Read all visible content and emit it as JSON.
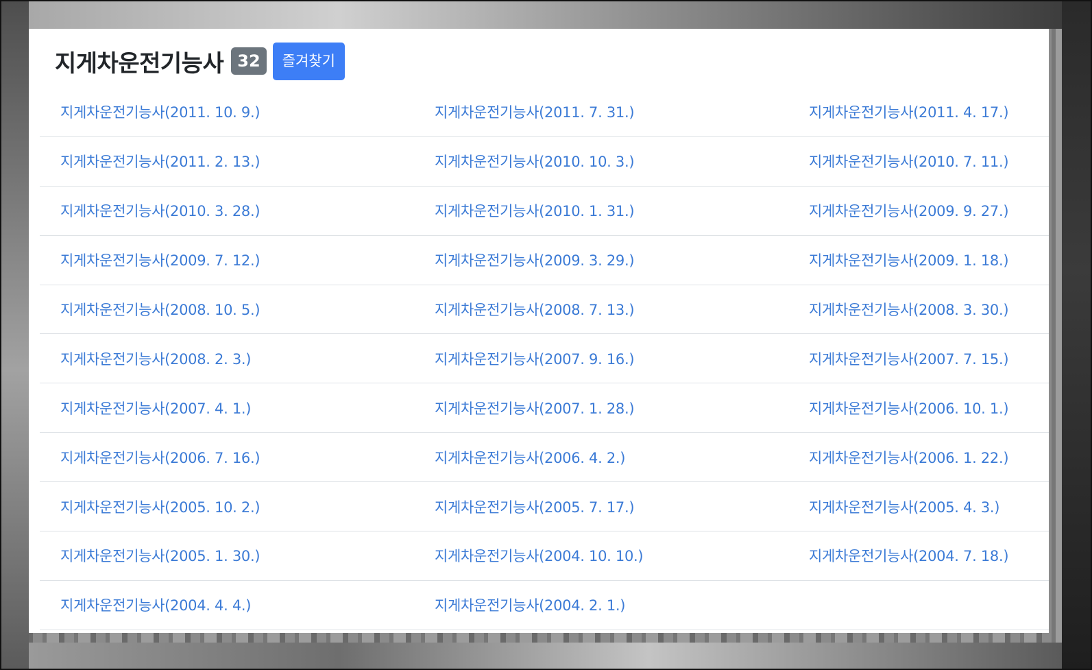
{
  "header": {
    "title": "지게차운전기능사",
    "count": "32",
    "favorite_label": "즐겨찾기"
  },
  "exams": [
    [
      "지게차운전기능사(2011. 10. 9.)",
      "지게차운전기능사(2011. 7. 31.)",
      "지게차운전기능사(2011. 4. 17.)"
    ],
    [
      "지게차운전기능사(2011. 2. 13.)",
      "지게차운전기능사(2010. 10. 3.)",
      "지게차운전기능사(2010. 7. 11.)"
    ],
    [
      "지게차운전기능사(2010. 3. 28.)",
      "지게차운전기능사(2010. 1. 31.)",
      "지게차운전기능사(2009. 9. 27.)"
    ],
    [
      "지게차운전기능사(2009. 7. 12.)",
      "지게차운전기능사(2009. 3. 29.)",
      "지게차운전기능사(2009. 1. 18.)"
    ],
    [
      "지게차운전기능사(2008. 10. 5.)",
      "지게차운전기능사(2008. 7. 13.)",
      "지게차운전기능사(2008. 3. 30.)"
    ],
    [
      "지게차운전기능사(2008. 2. 3.)",
      "지게차운전기능사(2007. 9. 16.)",
      "지게차운전기능사(2007. 7. 15.)"
    ],
    [
      "지게차운전기능사(2007. 4. 1.)",
      "지게차운전기능사(2007. 1. 28.)",
      "지게차운전기능사(2006. 10. 1.)"
    ],
    [
      "지게차운전기능사(2006. 7. 16.)",
      "지게차운전기능사(2006. 4. 2.)",
      "지게차운전기능사(2006. 1. 22.)"
    ],
    [
      "지게차운전기능사(2005. 10. 2.)",
      "지게차운전기능사(2005. 7. 17.)",
      "지게차운전기능사(2005. 4. 3.)"
    ],
    [
      "지게차운전기능사(2005. 1. 30.)",
      "지게차운전기능사(2004. 10. 10.)",
      "지게차운전기능사(2004. 7. 18.)"
    ],
    [
      "지게차운전기능사(2004. 4. 4.)",
      "지게차운전기능사(2004. 2. 1.)",
      ""
    ]
  ],
  "colors": {
    "link": "#3c7bd6",
    "button": "#3d7ef6",
    "badge": "#6c757d",
    "divider": "#dee2e6"
  }
}
